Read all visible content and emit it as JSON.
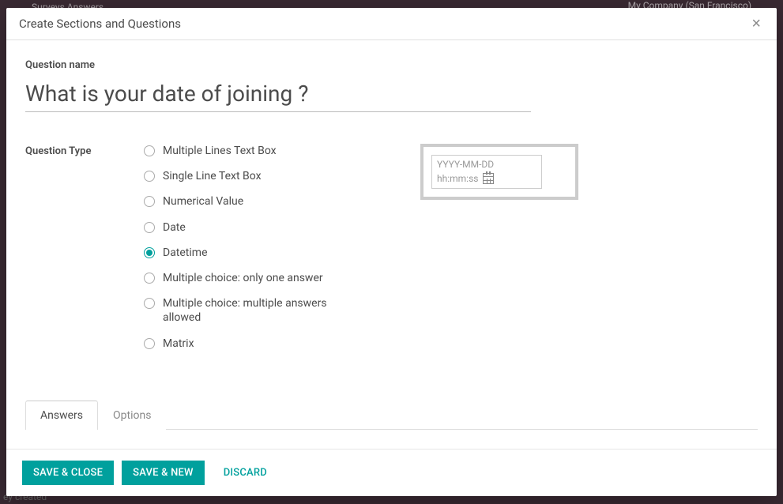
{
  "modal": {
    "title": "Create Sections and Questions"
  },
  "fields": {
    "question_name_label": "Question name",
    "question_name_value": "What is your date of joining ?",
    "question_type_label": "Question Type"
  },
  "type_options": [
    {
      "label": "Multiple Lines Text Box",
      "value": "text_box"
    },
    {
      "label": "Single Line Text Box",
      "value": "char_box"
    },
    {
      "label": "Numerical Value",
      "value": "numerical"
    },
    {
      "label": "Date",
      "value": "date"
    },
    {
      "label": "Datetime",
      "value": "datetime"
    },
    {
      "label": "Multiple choice: only one answer",
      "value": "simple_choice"
    },
    {
      "label": "Multiple choice: multiple answers allowed",
      "value": "multiple_choice"
    },
    {
      "label": "Matrix",
      "value": "matrix"
    }
  ],
  "selected_type": "datetime",
  "preview": {
    "date_placeholder": "YYYY-MM-DD",
    "time_placeholder": "hh:mm:ss"
  },
  "tabs": {
    "answers": "Answers",
    "options": "Options",
    "active": "answers"
  },
  "buttons": {
    "save_close": "Save & Close",
    "save_new": "Save & New",
    "discard": "Discard"
  },
  "background": {
    "top_nav": "Surveys    Answers",
    "top_right": "My Company (San Francisco)",
    "bottom_fragment": "ey created"
  },
  "colors": {
    "primary": "#00A09D"
  }
}
